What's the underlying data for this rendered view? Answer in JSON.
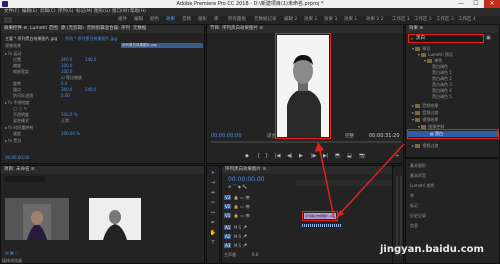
{
  "window": {
    "title": "Adobe Premiere Pro CC 2018 - D:\\新建项目(1)未命名.prproj *",
    "min": "—",
    "max": "☐",
    "close": "✕"
  },
  "menu": [
    "文件(F)",
    "编辑(E)",
    "剪辑(C)",
    "序列(S)",
    "标记(M)",
    "图形(G)",
    "窗口(W)",
    "帮助(H)"
  ],
  "workspaces": [
    "组件",
    "编辑",
    "颜色",
    "效果",
    "音频",
    "图形",
    "库",
    "所有面板",
    "元数据记录",
    "编辑 2",
    "效果 2",
    "效果 3",
    "效果 1",
    "效果 2 2",
    "工作区 1",
    "工作区 2",
    "工作区 3",
    "工作区 4"
  ],
  "effect_controls": {
    "tabs": [
      "效果控件 ≡",
      "Lumetri 范围",
      "源:(无剪辑)",
      "音频剪辑混合器: 序列",
      "元数据"
    ],
    "clip": "主要 * 序列黑白效果图片.jpg",
    "clip_right": "序列 * 序列黑白效果图片.jpg",
    "sequence_clip": "序列黑白效果图片.jpg",
    "section_video": "视频效果",
    "rows": [
      {
        "label": "运动",
        "value": ""
      },
      {
        "label": "位置",
        "value": "360.0",
        "value2": "240.0"
      },
      {
        "label": "缩放",
        "value": "100.0"
      },
      {
        "label": "缩放宽度",
        "value": "100.0"
      },
      {
        "label": "",
        "value": "☑ 等比缩放"
      },
      {
        "label": "旋转",
        "value": "0.0"
      },
      {
        "label": "锚点",
        "value": "360.0",
        "value2": "240.0"
      },
      {
        "label": "防闪烁滤镜",
        "value": "0.00"
      },
      {
        "label": "不透明度",
        "value": ""
      },
      {
        "label": "不透明度",
        "value": "100.0 %"
      },
      {
        "label": "混合模式",
        "value": "正常"
      },
      {
        "label": "时间重映射",
        "value": ""
      },
      {
        "label": "速度",
        "value": "100.00 %"
      },
      {
        "label": "黑白",
        "value": ""
      }
    ],
    "timecode": "00;00;00;00"
  },
  "program": {
    "tab": "节目: 序列黑白效果图片 ≡",
    "timecode_left": "00:00:00:00",
    "fit": "适合",
    "full": "完整",
    "timecode_right": "00:00:31:20",
    "controls": [
      "◆",
      "{",
      "}",
      "|◀",
      "◀|",
      "▶",
      "|▶",
      "▶|",
      "⬒",
      "⬓",
      "📷",
      "+"
    ]
  },
  "effects": {
    "tab": "效果 ≡",
    "search": "黑白",
    "items": [
      "预设",
      "Lumetri 预设",
      "单色",
      "黑白调色",
      "黑白调色 1",
      "黑白调色 2",
      "黑白调色 3",
      "黑白调色 4",
      "黑白调色 5",
      "音频效果",
      "音频过渡",
      "视频效果",
      "图像控制",
      "黑白",
      "视频过渡"
    ],
    "bottom_items": [
      "基本图形",
      "基本声音",
      "Lumetri 颜色",
      "库",
      "标记",
      "历史记录",
      "信息"
    ]
  },
  "project": {
    "tab": "项目: 未命名 ≡",
    "footer": "媒体浏览器"
  },
  "timeline": {
    "tab": "序列黑白效果图片 ≡",
    "timecode": "00:00:00:00",
    "tracks_v": [
      "V3",
      "V2",
      "V1"
    ],
    "tracks_a": [
      "A1",
      "A2",
      "A3"
    ],
    "master": "主声道",
    "master_val": "0.0",
    "clip_label": "序列黑白效果图片.jpg"
  },
  "watermark": "jingyan.baidu.com",
  "colors": {
    "accent": "#4e8fe0",
    "highlight": "#e62117",
    "panel": "#232323"
  }
}
